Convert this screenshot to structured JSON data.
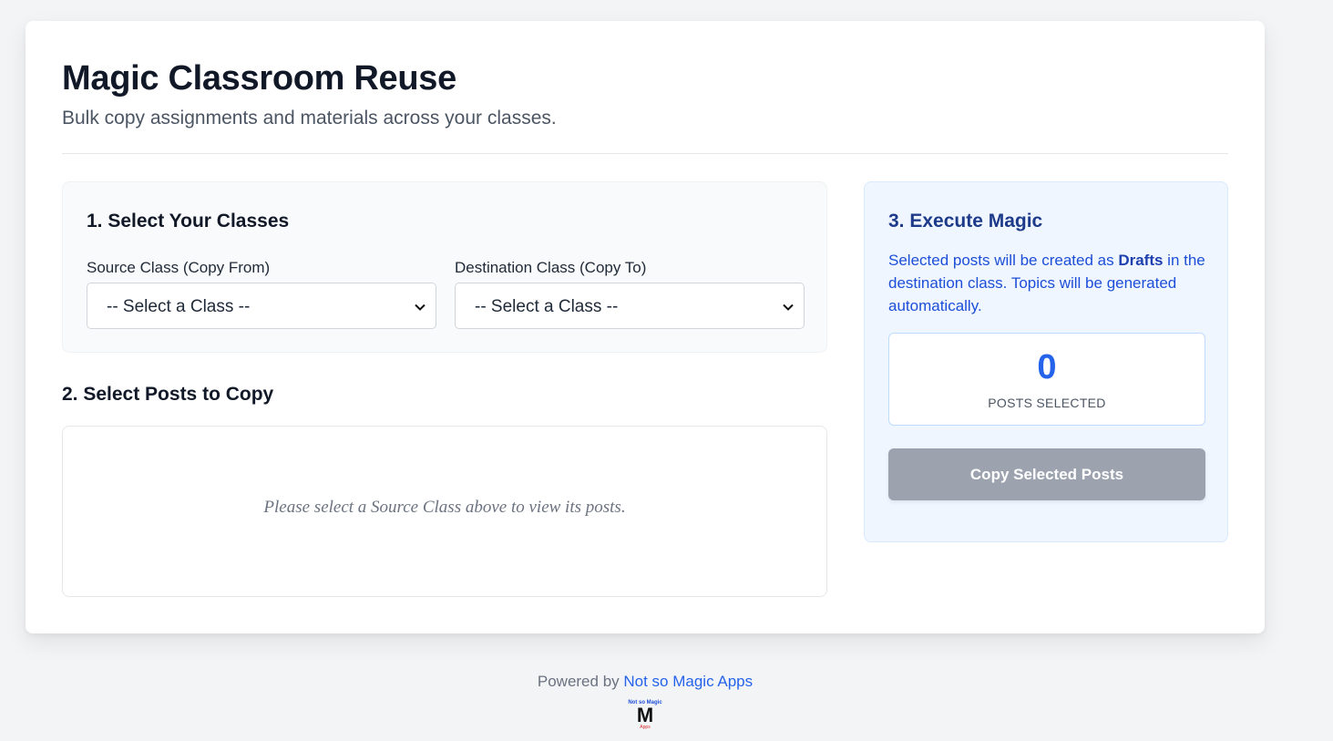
{
  "header": {
    "title": "Magic Classroom Reuse",
    "subtitle": "Bulk copy assignments and materials across your classes."
  },
  "step1": {
    "title": "1. Select Your Classes",
    "source_label": "Source Class (Copy From)",
    "source_value": "-- Select a Class --",
    "dest_label": "Destination Class (Copy To)",
    "dest_value": "-- Select a Class --"
  },
  "step2": {
    "title": "2. Select Posts to Copy",
    "empty_message": "Please select a Source Class above to view its posts."
  },
  "step3": {
    "title": "3. Execute Magic",
    "desc_before": "Selected posts will be created as ",
    "desc_bold": "Drafts",
    "desc_after": " in the destination class. Topics will be generated automatically.",
    "count": "0",
    "count_label": "POSTS SELECTED",
    "button_label": "Copy Selected Posts"
  },
  "footer": {
    "prefix": "Powered by ",
    "brand": "Not so Magic Apps"
  },
  "logo": {
    "top_text": "Not so Magic",
    "letter": "M",
    "bottom_text": "Apps"
  },
  "colors": {
    "accent": "#2563eb",
    "button_disabled": "#9ca3af",
    "panel_blue": "#eff6ff"
  }
}
